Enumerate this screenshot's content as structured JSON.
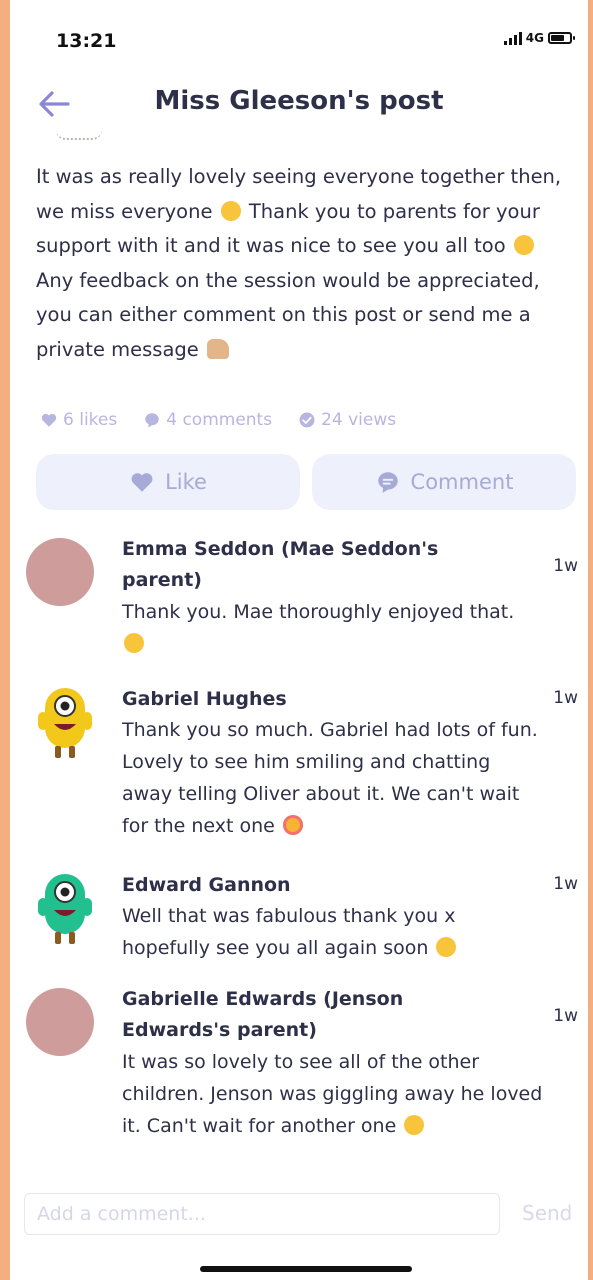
{
  "status_bar": {
    "time": "13:21",
    "network": "4G"
  },
  "header": {
    "title": "Miss Gleeson's post"
  },
  "post": {
    "text_parts": {
      "p1": "It was as really lovely seeing everyone together then, we miss everyone",
      "p2": "Thank you to parents for your support with it and it was nice to see you all too",
      "p3": "Any feedback on the session would be appreciated, you can either comment on this post or send me a private message"
    },
    "stats": {
      "likes": "6 likes",
      "comments": "4 comments",
      "views": "24 views"
    },
    "buttons": {
      "like": "Like",
      "comment": "Comment"
    }
  },
  "comments": [
    {
      "name": "Emma Seddon (Mae Seddon's parent)",
      "text": "Thank you. Mae thoroughly enjoyed that.",
      "time": "1w",
      "avatar": "pink-circle"
    },
    {
      "name": "Gabriel Hughes",
      "text": "Thank you so much. Gabriel had lots of fun. Lovely to see him smiling and chatting away telling Oliver about it. We can't wait for the next one",
      "time": "1w",
      "avatar": "yellow-monster"
    },
    {
      "name": "Edward Gannon",
      "text": "Well that was fabulous thank you x hopefully see you all again soon",
      "time": "1w",
      "avatar": "green-monster"
    },
    {
      "name": "Gabrielle  Edwards (Jenson Edwards's parent)",
      "text": "It was so lovely to see all of the other children. Jenson was giggling away he loved it. Can't wait for another one",
      "time": "1w",
      "avatar": "pink-circle"
    }
  ],
  "composer": {
    "placeholder": "Add a comment...",
    "send_label": "Send"
  },
  "colors": {
    "accent": "#8a88d6",
    "muted": "#b7b6e0",
    "button_bg": "#eef0fb",
    "avatar_pink": "#cf9c9c"
  }
}
